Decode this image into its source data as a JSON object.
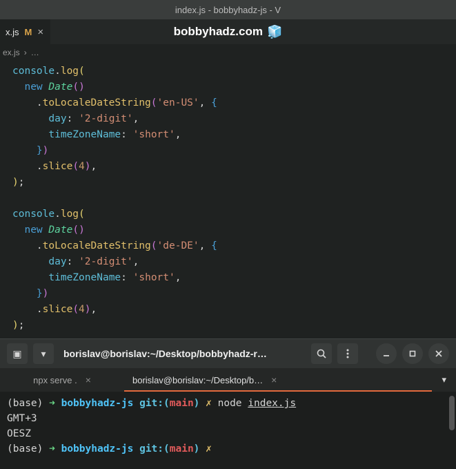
{
  "titlebar": {
    "text": "index.js - bobbyhadz-js - V"
  },
  "tab": {
    "name": "x.js",
    "modified": "M",
    "close": "×"
  },
  "brand": {
    "label": "bobbyhadz.com",
    "emoji": "🧊"
  },
  "breadcrumb": {
    "file": "ex.js",
    "sep": "›",
    "more": "…"
  },
  "code": {
    "console": "console",
    "log": "log",
    "new_kw": "new",
    "date": "Date",
    "toLocale": "toLocaleDateString",
    "locale1": "'en-US'",
    "locale2": "'de-DE'",
    "day_key": "day",
    "day_val": "'2-digit'",
    "tz_key": "timeZoneName",
    "tz_val": "'short'",
    "slice": "slice",
    "slice_arg": "4",
    "dot": ".",
    "colon": ":",
    "comma": ",",
    "semi": ";",
    "lp_y": "(",
    "rp_y": ")",
    "lp_p": "(",
    "rp_p": ")",
    "lp_b": "(",
    "rp_b": ")",
    "lb_p": "{",
    "rb_p": "}"
  },
  "terminal": {
    "header_title": "borislav@borislav:~/Desktop/bobbyhadz-r…",
    "tabs": {
      "tab1": "npx serve .",
      "tab2": "borislav@borislav:~/Desktop/b…",
      "close": "×",
      "dropdown": "▾"
    },
    "prompt": {
      "base": "(base)",
      "arrow": "➜",
      "dir": "bobbyhadz-js",
      "git": "git:",
      "lp": "(",
      "branch": "main",
      "rp": ")",
      "x": "✗",
      "cmd": "node",
      "file": "index.js"
    },
    "output": {
      "line1": "GMT+3",
      "line2": "OESZ"
    }
  }
}
